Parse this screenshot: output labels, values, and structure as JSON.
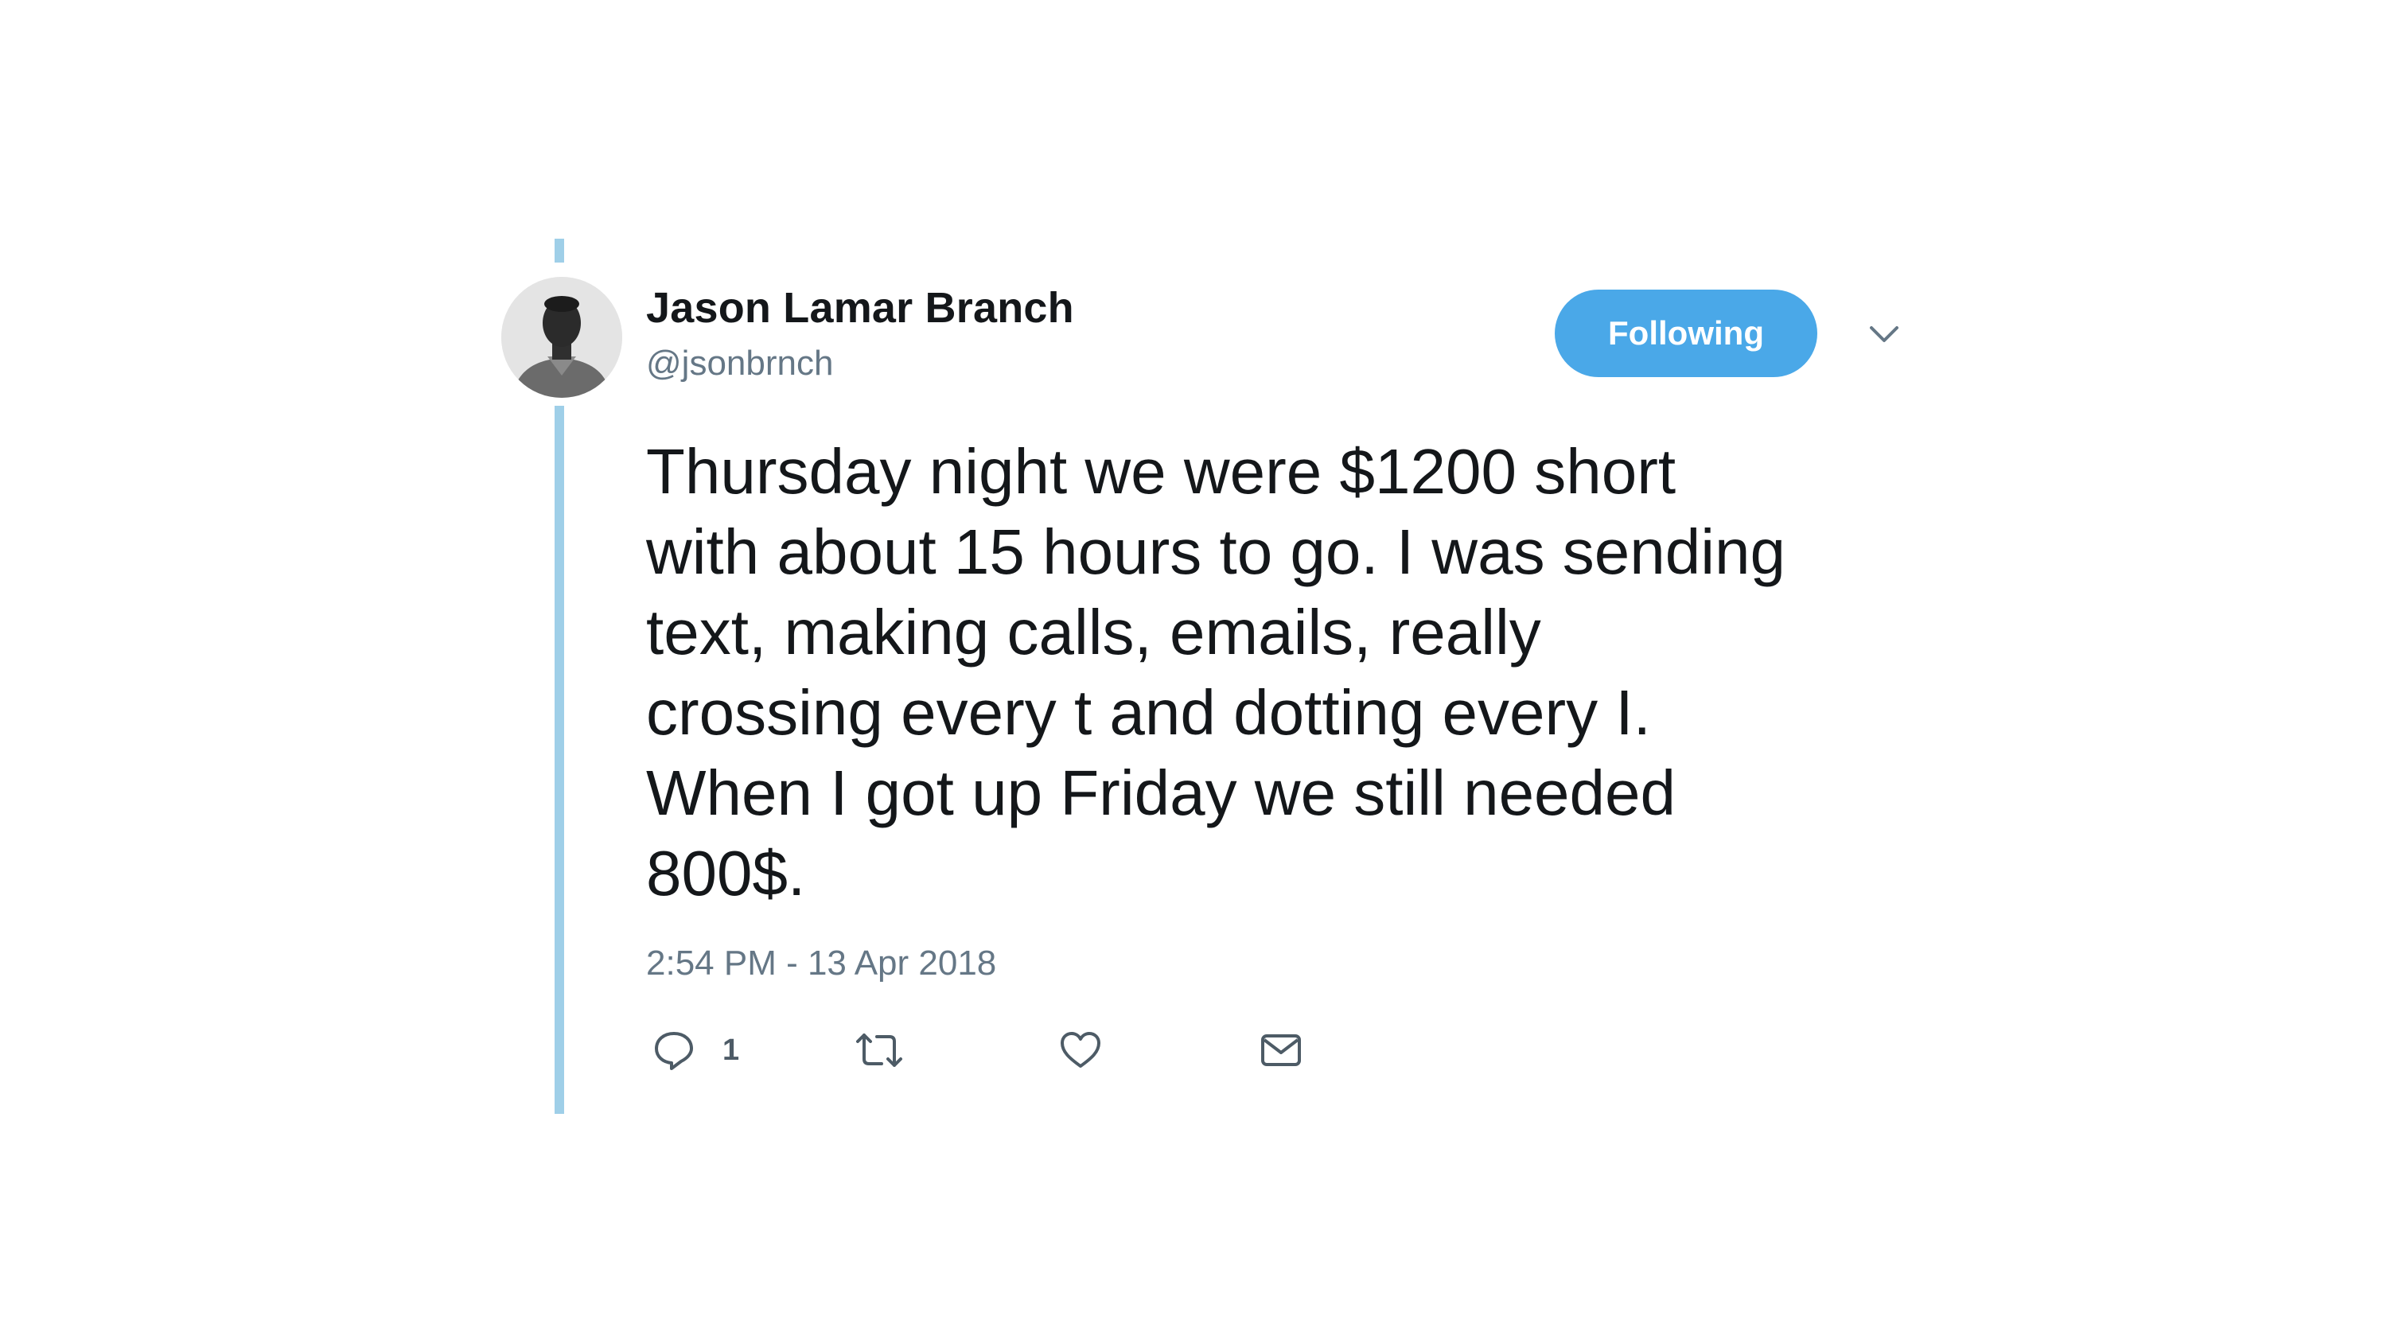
{
  "tweet": {
    "author": {
      "display_name": "Jason Lamar Branch",
      "handle": "@jsonbrnch",
      "avatar_icon": "profile-photo"
    },
    "follow_button_label": "Following",
    "menu_icon": "chevron-down-icon",
    "text": "Thursday night we were $1200 short\nwith about 15 hours to go. I was sending\ntext, making calls, emails, really\ncrossing every t and dotting every I.\nWhen I got up Friday we still needed\n800$.",
    "timestamp": "2:54 PM - 13 Apr 2018",
    "actions": {
      "reply_count": "1",
      "reply_icon": "reply-icon",
      "retweet_icon": "retweet-icon",
      "like_icon": "heart-icon",
      "message_icon": "envelope-icon"
    }
  },
  "colors": {
    "accent": "#4aa8e8",
    "thread_line": "#9fcfe8",
    "secondary_text": "#657786",
    "primary_text": "#14171a"
  }
}
